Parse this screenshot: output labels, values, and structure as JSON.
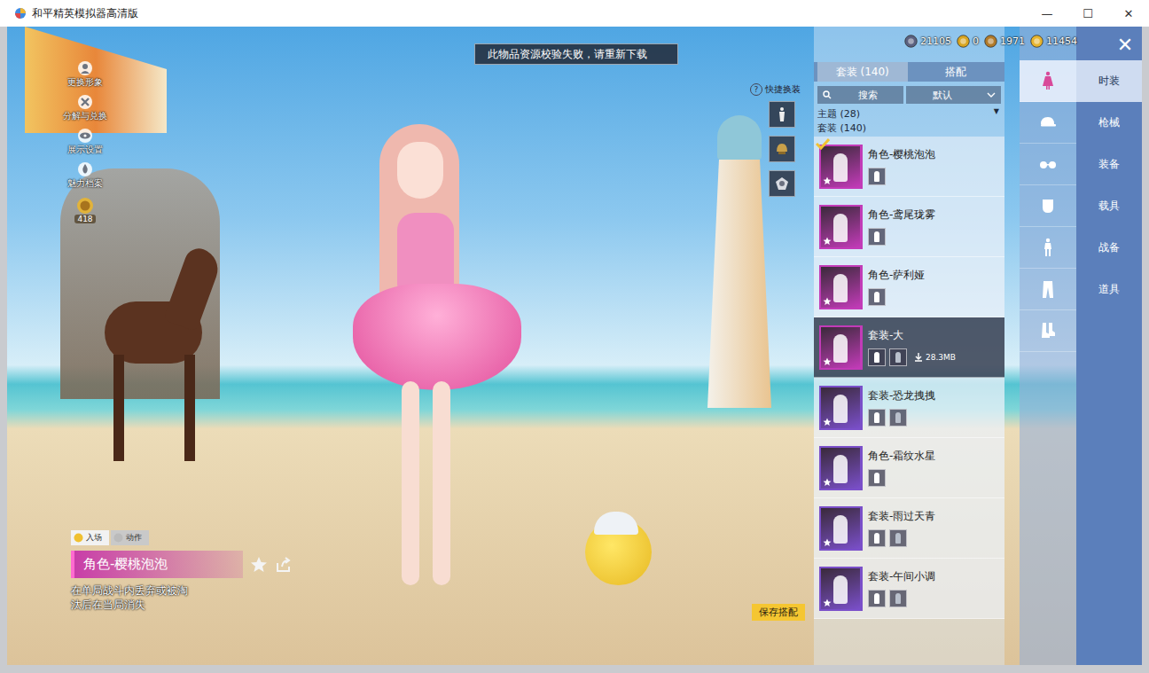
{
  "window": {
    "title": "和平精英模拟器高清版",
    "controls": [
      "—",
      "☐",
      "✕"
    ]
  },
  "toast": "此物品资源校验失败，请重新下载",
  "currencies": [
    {
      "amount": "21105",
      "color": "#5b6180"
    },
    {
      "amount": "0",
      "color": "#d9a520"
    },
    {
      "amount": "1971",
      "color": "#b07a2a"
    },
    {
      "amount": "11454",
      "color": "#e6b42e"
    }
  ],
  "close": "✕",
  "side_actions": [
    {
      "label": "更换形象"
    },
    {
      "label": "分解与兑换"
    },
    {
      "label": "展示设置"
    },
    {
      "label": "魅力档案"
    }
  ],
  "charm_badge": "418",
  "quick_change": {
    "label": "快捷换装",
    "help": "?",
    "slots": [
      {
        "kind": "outfit"
      },
      {
        "kind": "helmet"
      },
      {
        "kind": "badge"
      }
    ]
  },
  "item_info": {
    "tags": [
      {
        "label": "入场",
        "selected": true
      },
      {
        "label": "动作",
        "selected": false
      }
    ],
    "name": "角色-樱桃泡泡",
    "description": "在单局战斗内丢弃或被淘汰后在当局消失",
    "favorited": false
  },
  "save_button": "保存搭配",
  "panel": {
    "tabs": [
      {
        "label": "套装 (140)",
        "selected": true
      },
      {
        "label": "搭配",
        "selected": false
      }
    ],
    "search_placeholder": "搜索",
    "sort": "默认",
    "theme_header": "主题 (28)",
    "theme_arrow": "▼",
    "list_header": "套装 (140)",
    "items": [
      {
        "name": "角色-樱桃泡泡",
        "kind": "role",
        "selected": true,
        "color": "#c23bb8",
        "downloading": false,
        "size": ""
      },
      {
        "name": "角色-鸢尾珑雾",
        "kind": "role",
        "selected": false,
        "color": "#c23bb8",
        "downloading": false,
        "size": ""
      },
      {
        "name": "角色-萨利娅",
        "kind": "role",
        "selected": false,
        "color": "#c23bb8",
        "downloading": false,
        "size": ""
      },
      {
        "name": "套装-大",
        "kind": "set",
        "selected": false,
        "color": "#c23bb8",
        "downloading": true,
        "size": "28.3MB"
      },
      {
        "name": "套装-恐龙拽拽",
        "kind": "set",
        "selected": false,
        "color": "#7a4fc9",
        "downloading": false,
        "size": ""
      },
      {
        "name": "角色-霜纹水星",
        "kind": "role",
        "selected": false,
        "color": "#7a4fc9",
        "downloading": false,
        "size": ""
      },
      {
        "name": "套装-雨过天青",
        "kind": "set",
        "selected": false,
        "color": "#7a4fc9",
        "downloading": false,
        "size": ""
      },
      {
        "name": "套装-午间小调",
        "kind": "set",
        "selected": false,
        "color": "#7a4fc9",
        "downloading": false,
        "size": ""
      }
    ]
  },
  "category_icons": [
    {
      "selected": true
    },
    {
      "selected": false
    },
    {
      "selected": false
    },
    {
      "selected": false
    },
    {
      "selected": false
    },
    {
      "selected": false
    },
    {
      "selected": false
    }
  ],
  "categories": [
    {
      "label": "时装",
      "selected": true
    },
    {
      "label": "枪械",
      "selected": false
    },
    {
      "label": "装备",
      "selected": false
    },
    {
      "label": "载具",
      "selected": false
    },
    {
      "label": "战备",
      "selected": false
    },
    {
      "label": "道具",
      "selected": false
    }
  ]
}
